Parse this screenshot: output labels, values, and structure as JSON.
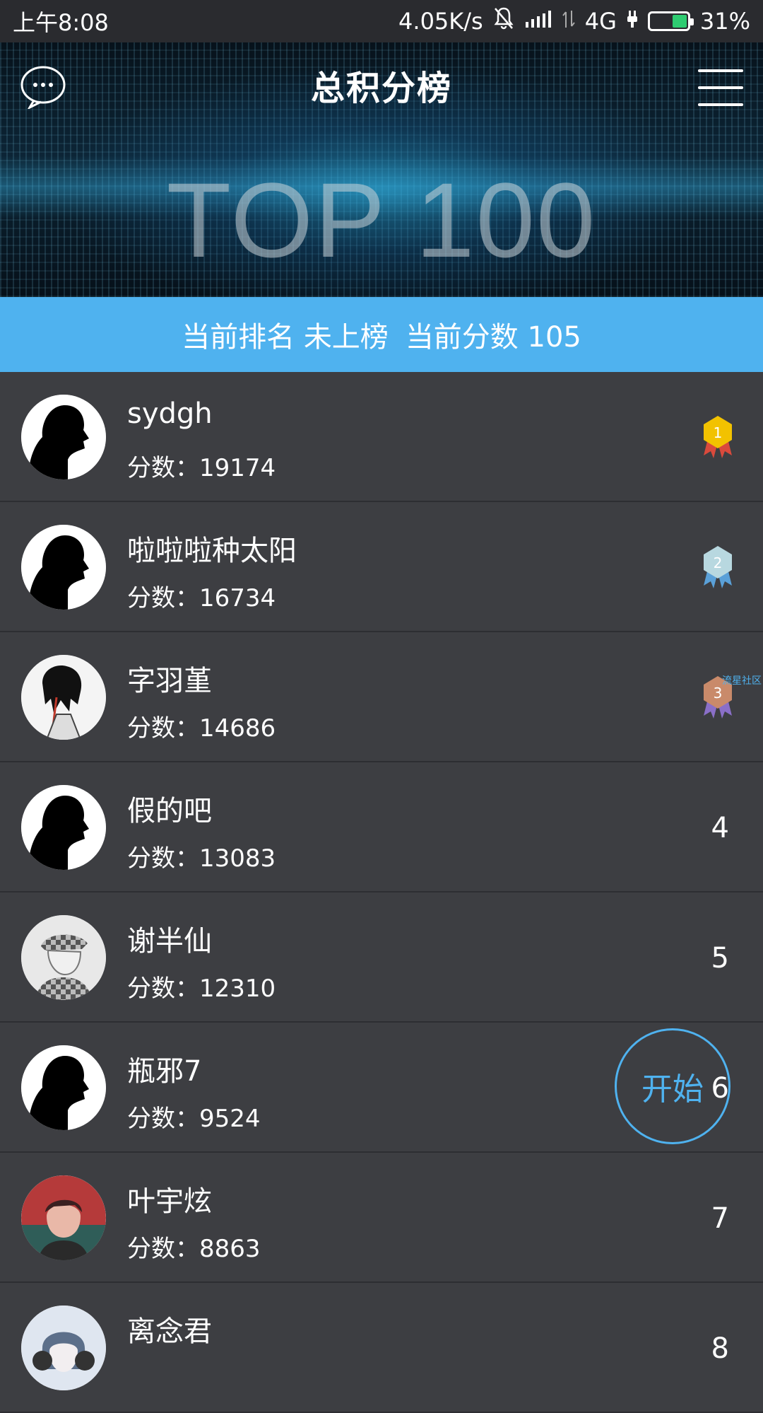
{
  "status_bar": {
    "time": "上午8:08",
    "net_speed": "4.05K/s",
    "network": "4G",
    "battery": "31%"
  },
  "header": {
    "title": "总积分榜",
    "chat_icon": "chat-bubble-icon",
    "menu_icon": "hamburger-menu-icon"
  },
  "hero": {
    "big_text": "TOP 100"
  },
  "rank_banner": {
    "rank_label": "当前排名",
    "rank_value": "未上榜",
    "score_label": "当前分数",
    "score_value": "105"
  },
  "leaderboard": {
    "score_prefix": "分数：",
    "entries": [
      {
        "rank": 1,
        "name": "sydgh",
        "score": "19174",
        "badge": "gold-medal-icon",
        "avatar": "silhouette"
      },
      {
        "rank": 2,
        "name": "啦啦啦种太阳",
        "score": "16734",
        "badge": "silver-medal-icon",
        "avatar": "silhouette"
      },
      {
        "rank": 3,
        "name": "字羽堇",
        "score": "14686",
        "badge": "bronze-medal-icon",
        "avatar": "anime-sketch"
      },
      {
        "rank": 4,
        "name": "假的吧",
        "score": "13083",
        "rank_text": "4",
        "avatar": "silhouette"
      },
      {
        "rank": 5,
        "name": "谢半仙",
        "score": "12310",
        "rank_text": "5",
        "avatar": "checkered-hat-portrait"
      },
      {
        "rank": 6,
        "name": "瓶邪7",
        "score": "9524",
        "rank_text": "6",
        "avatar": "silhouette"
      },
      {
        "rank": 7,
        "name": "叶宇炫",
        "score": "8863",
        "rank_text": "7",
        "avatar": "red-portrait"
      },
      {
        "rank": 8,
        "name": "离念君",
        "score": "",
        "rank_text": "8",
        "avatar": "blue-portrait"
      }
    ]
  },
  "floating": {
    "start_label": "开始"
  },
  "watermark": "流星社区",
  "colors": {
    "accent": "#4fb2ef",
    "background": "#3d3e42",
    "gold": "#f2c200",
    "silver": "#b8d8e0",
    "bronze": "#c98a6a"
  }
}
